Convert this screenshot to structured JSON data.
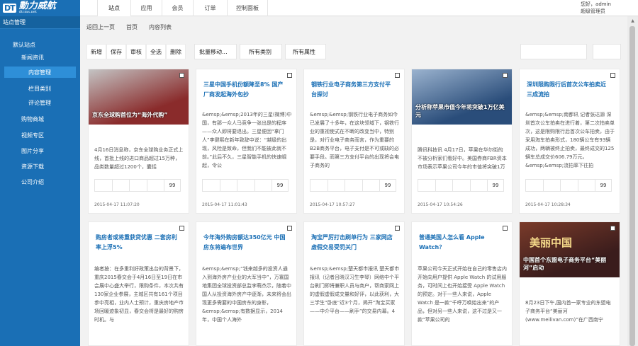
{
  "logo": {
    "mark": "DT",
    "brand": "動力威航",
    "sub": "dtcms.net"
  },
  "top_nav": [
    "站点",
    "应用",
    "会员",
    "订单",
    "控制面板"
  ],
  "user": {
    "greeting": "您好，admin",
    "role": "超级管理员"
  },
  "sidebar": {
    "title": "站点管理",
    "items": [
      {
        "label": "默认站点"
      },
      {
        "label": "新闻资讯"
      },
      {
        "label": "内容管理"
      },
      {
        "label": "栏目类别"
      },
      {
        "label": "评论管理"
      },
      {
        "label": "购物商城"
      },
      {
        "label": "视频专区"
      },
      {
        "label": "图片分享"
      },
      {
        "label": "资源下载"
      },
      {
        "label": "公司介绍"
      }
    ]
  },
  "breadcrumb": {
    "back": "返回上一页",
    "home": "首页",
    "current": "内容列表"
  },
  "toolbar": {
    "buttons": [
      "新增",
      "保存",
      "审核",
      "全选",
      "删除"
    ],
    "batch": "批量移动...",
    "category": "所有类别",
    "attribute": "所有属性"
  },
  "cards": [
    {
      "type": "image",
      "caption": "京东全球购首位为“海外代购”",
      "body": "4月16日消息称，京东全球购业务正式上线，首批上线的进口商品超过15万种，品类数量超过1200个，囊括",
      "count": "99",
      "date": "2015-04-17 11:07:20",
      "image_colors": [
        "#8a2b2b",
        "#c4c4c4"
      ]
    },
    {
      "type": "text",
      "title": "三星中国手机份额降至8% 国产厂商发起海外包抄",
      "body": "&emsp;&emsp;2013年的三星(微博)中国，有那一众人马竞争一张出是的程序——众人即将要退出。三星便因“拿门人”李健熙在新年致辞中说：“越级的出现，风险是致命，但我们不能被此就不前。”此后不久，三星智能手机的快速崛起，令公",
      "count": "99",
      "date": "2015-04-17 11:01:43"
    },
    {
      "type": "text",
      "title": "钢铁行业电子商务第三方支付平台探讨",
      "body": "&emsp;&emsp;钢铁行业电子商务如今已发展了十多年，在这块领域下，钢铁行业的重视使式在不断的改变当中，特别是，对行业电子商务而言，作为重要的B2B商务平台，电子支付是不可或缺的必要手段。而第三方支付平台的出现将会电子商务的",
      "count": "99",
      "date": "2015-04-17 10:57:27"
    },
    {
      "type": "image",
      "caption": "分析称苹果市值今年将突破1万亿美元",
      "body": "腾讯科技讯 4月17日，苹果在华尔街的不被分析家们看好中。美国券商FBR资本市场表示苹果公司今年的市值将突破1万亿美元",
      "count": "99",
      "date": "2015-04-17 10:54:26",
      "image_colors": [
        "#2a4d7a",
        "#9bb3cf"
      ]
    },
    {
      "type": "text",
      "title": "深圳限购限行后首次公车拍卖近三成流拍",
      "body": "&emsp;&emsp;南都讯 记者张达源 深圳首次公车拍卖在进行着，第二次拍卖单次，这是限购限行后首次公车拍卖，由于采用淘车拍卖形式，180辆公车有93辆成功，两辆被终止拍卖，最终成交的125辆车总成交价606.79万元。&emsp;&emsp;流拍率下往拍",
      "count": "99",
      "date": "2015-04-17 10:28:34"
    },
    {
      "type": "text",
      "title": "购房者或将重获贷优惠 二套房利率上浮5%",
      "body": "编者按：在多重利好政策出台的背景下，重庆2015春交会于4月16日至19日在市会展中心盛大举行，限购条件，本次共有130家企业参展，主城区共有161个项目参中亮相，业内人士预计，重庆房地产市场回暖迹象初显，春交会将是最好的购房时机。与",
      "count": "99",
      "date": ""
    },
    {
      "type": "text",
      "title": "今年海外购房额达350亿元 中国房东将遍布世界",
      "body": "&emsp;&emsp;“钱来越多的投资人通入到海外房产业业的大军当中”，万寰国地集团全球投资部总监李萌杰示，随着中国人从投资海外房产中逐渐，未来将会出现更多需要的中国房东的身影，&emsp;&emsp;有数据显示，2014年，中国个人海外",
      "count": "99",
      "date": ""
    },
    {
      "type": "text",
      "title": "淘宝严厉打击刷单行为 三家网店虚假交易受罚关门",
      "body": "&emsp;&emsp;楚天都市报讯 楚天都市报讯（记者吕晓汉习生李琴）网络中个平台刷门即将兼职人员与商户，帮商家网上的虚假虚假成交量和好评，以此获利，大三学生“卧底”近3个月，揭开“淘宝买家——中介平台——刷手”的交易内幕。4",
      "count": "99",
      "date": ""
    },
    {
      "type": "text",
      "title": "普通美国人怎么看 Apple Watch？",
      "body": "苹果公司今天正式开始在自己的零售店内开始向用户提供 Apple Watch 的试用服务，可时间上也开始接受 Apple Watch 的预定。对于一些人来说，Apple Watch 是一款“千呼万唤始出来”的产品，但对另一些人来说，这不过是又一款“苹果公司的",
      "count": "99",
      "date": ""
    },
    {
      "type": "image",
      "caption": "中国首个东盟电子商务平台“美丽河”启动",
      "body": "8月23日下午,国内首一家专业的东盟电子商务平台“美丽河(www.meilivan.com)”在广西南宁",
      "count": "99",
      "date": "",
      "image_text": "美丽中国",
      "image_colors": [
        "#3a1c1c",
        "#7a3b2a"
      ]
    }
  ]
}
